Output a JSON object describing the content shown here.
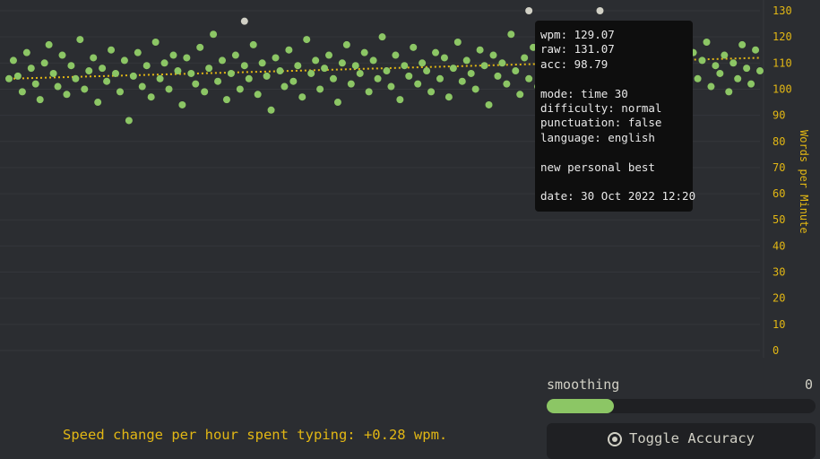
{
  "colors": {
    "background": "#2b2d31",
    "accent": "#e2b714",
    "points": "#8cc665",
    "personal_best": "#d1d0c5",
    "trend": "#e2b714"
  },
  "chart_data": {
    "type": "scatter",
    "ylabel": "Words per Minute",
    "ylim": [
      0,
      130
    ],
    "yticks": [
      0,
      10,
      20,
      30,
      40,
      50,
      60,
      70,
      80,
      90,
      100,
      110,
      120,
      130
    ],
    "grid": true,
    "axis_position": "right",
    "trend_line": {
      "y_start": 104,
      "y_end": 112
    },
    "series": [
      {
        "values": [
          [
            0,
            104
          ],
          [
            1,
            111
          ],
          [
            2,
            105
          ],
          [
            3,
            99
          ],
          [
            4,
            114
          ],
          [
            5,
            108
          ],
          [
            6,
            102
          ],
          [
            7,
            96
          ],
          [
            8,
            110
          ],
          [
            9,
            117
          ],
          [
            10,
            106
          ],
          [
            11,
            101
          ],
          [
            12,
            113
          ],
          [
            13,
            98
          ],
          [
            14,
            109
          ],
          [
            15,
            104
          ],
          [
            16,
            119
          ],
          [
            17,
            100
          ],
          [
            18,
            107
          ],
          [
            19,
            112
          ],
          [
            20,
            95
          ],
          [
            21,
            108
          ],
          [
            22,
            103
          ],
          [
            23,
            115
          ],
          [
            24,
            106
          ],
          [
            25,
            99
          ],
          [
            26,
            111
          ],
          [
            27,
            88
          ],
          [
            28,
            105
          ],
          [
            29,
            114
          ],
          [
            30,
            101
          ],
          [
            31,
            109
          ],
          [
            32,
            97
          ],
          [
            33,
            118
          ],
          [
            34,
            104
          ],
          [
            35,
            110
          ],
          [
            36,
            100
          ],
          [
            37,
            113
          ],
          [
            38,
            107
          ],
          [
            39,
            94
          ],
          [
            40,
            112
          ],
          [
            41,
            106
          ],
          [
            42,
            102
          ],
          [
            43,
            116
          ],
          [
            44,
            99
          ],
          [
            45,
            108
          ],
          [
            46,
            121
          ],
          [
            47,
            103
          ],
          [
            48,
            111
          ],
          [
            49,
            96
          ],
          [
            50,
            106
          ],
          [
            51,
            113
          ],
          [
            52,
            100
          ],
          [
            53,
            109
          ],
          [
            54,
            104
          ],
          [
            55,
            117
          ],
          [
            56,
            98
          ],
          [
            57,
            110
          ],
          [
            58,
            105
          ],
          [
            59,
            92
          ],
          [
            60,
            112
          ],
          [
            61,
            107
          ],
          [
            62,
            101
          ],
          [
            63,
            115
          ],
          [
            64,
            103
          ],
          [
            65,
            109
          ],
          [
            66,
            97
          ],
          [
            67,
            119
          ],
          [
            68,
            106
          ],
          [
            69,
            111
          ],
          [
            70,
            100
          ],
          [
            71,
            108
          ],
          [
            72,
            113
          ],
          [
            73,
            104
          ],
          [
            74,
            95
          ],
          [
            75,
            110
          ],
          [
            76,
            117
          ],
          [
            77,
            102
          ],
          [
            78,
            109
          ],
          [
            79,
            106
          ],
          [
            80,
            114
          ],
          [
            81,
            99
          ],
          [
            82,
            111
          ],
          [
            83,
            104
          ],
          [
            84,
            120
          ],
          [
            85,
            107
          ],
          [
            86,
            101
          ],
          [
            87,
            113
          ],
          [
            88,
            96
          ],
          [
            89,
            109
          ],
          [
            90,
            105
          ],
          [
            91,
            116
          ],
          [
            92,
            102
          ],
          [
            93,
            110
          ],
          [
            94,
            107
          ],
          [
            95,
            99
          ],
          [
            96,
            114
          ],
          [
            97,
            104
          ],
          [
            98,
            112
          ],
          [
            99,
            97
          ],
          [
            100,
            108
          ],
          [
            101,
            118
          ],
          [
            102,
            103
          ],
          [
            103,
            111
          ],
          [
            104,
            106
          ],
          [
            105,
            100
          ],
          [
            106,
            115
          ],
          [
            107,
            109
          ],
          [
            108,
            94
          ],
          [
            109,
            113
          ],
          [
            110,
            105
          ],
          [
            111,
            110
          ],
          [
            112,
            102
          ],
          [
            113,
            121
          ],
          [
            114,
            107
          ],
          [
            115,
            98
          ],
          [
            116,
            112
          ],
          [
            117,
            104
          ],
          [
            118,
            116
          ],
          [
            119,
            101
          ],
          [
            120,
            109
          ],
          [
            121,
            106
          ],
          [
            122,
            114
          ],
          [
            123,
            99
          ],
          [
            124,
            111
          ],
          [
            125,
            103
          ],
          [
            126,
            119
          ],
          [
            127,
            108
          ],
          [
            128,
            96
          ],
          [
            129,
            113
          ],
          [
            130,
            104
          ],
          [
            131,
            110
          ],
          [
            132,
            101
          ],
          [
            133,
            117
          ],
          [
            134,
            107
          ],
          [
            135,
            112
          ],
          [
            136,
            98
          ],
          [
            137,
            109
          ],
          [
            138,
            115
          ],
          [
            139,
            103
          ],
          [
            140,
            111
          ],
          [
            141,
            106
          ],
          [
            142,
            120
          ],
          [
            143,
            100
          ],
          [
            144,
            108
          ],
          [
            145,
            113
          ],
          [
            146,
            95
          ],
          [
            147,
            110
          ],
          [
            148,
            105
          ],
          [
            149,
            116
          ],
          [
            150,
            102
          ],
          [
            151,
            112
          ],
          [
            152,
            107
          ],
          [
            153,
            98
          ],
          [
            154,
            114
          ],
          [
            155,
            104
          ],
          [
            156,
            111
          ],
          [
            157,
            118
          ],
          [
            158,
            101
          ],
          [
            159,
            109
          ],
          [
            160,
            106
          ],
          [
            161,
            113
          ],
          [
            162,
            99
          ],
          [
            163,
            110
          ],
          [
            164,
            104
          ],
          [
            165,
            117
          ],
          [
            166,
            108
          ],
          [
            167,
            102
          ],
          [
            168,
            115
          ],
          [
            169,
            107
          ]
        ]
      },
      {
        "name": "personal best",
        "values": [
          [
            53,
            126
          ],
          [
            117,
            130
          ],
          [
            133,
            130
          ]
        ]
      }
    ]
  },
  "tooltip": {
    "lines": [
      "wpm: 129.07",
      "raw: 131.07",
      "acc: 98.79",
      "",
      "mode: time 30",
      "difficulty: normal",
      "punctuation: false",
      "language: english",
      "",
      "new personal best",
      "",
      "date: 30 Oct 2022 12:20"
    ]
  },
  "controls": {
    "smoothing_label": "smoothing",
    "smoothing_value": "0",
    "smoothing_fill": 0.25,
    "toggle_label": "Toggle Accuracy",
    "toggle_icon": "target-icon"
  },
  "speed_note": "Speed change per hour spent typing: +0.28 wpm."
}
